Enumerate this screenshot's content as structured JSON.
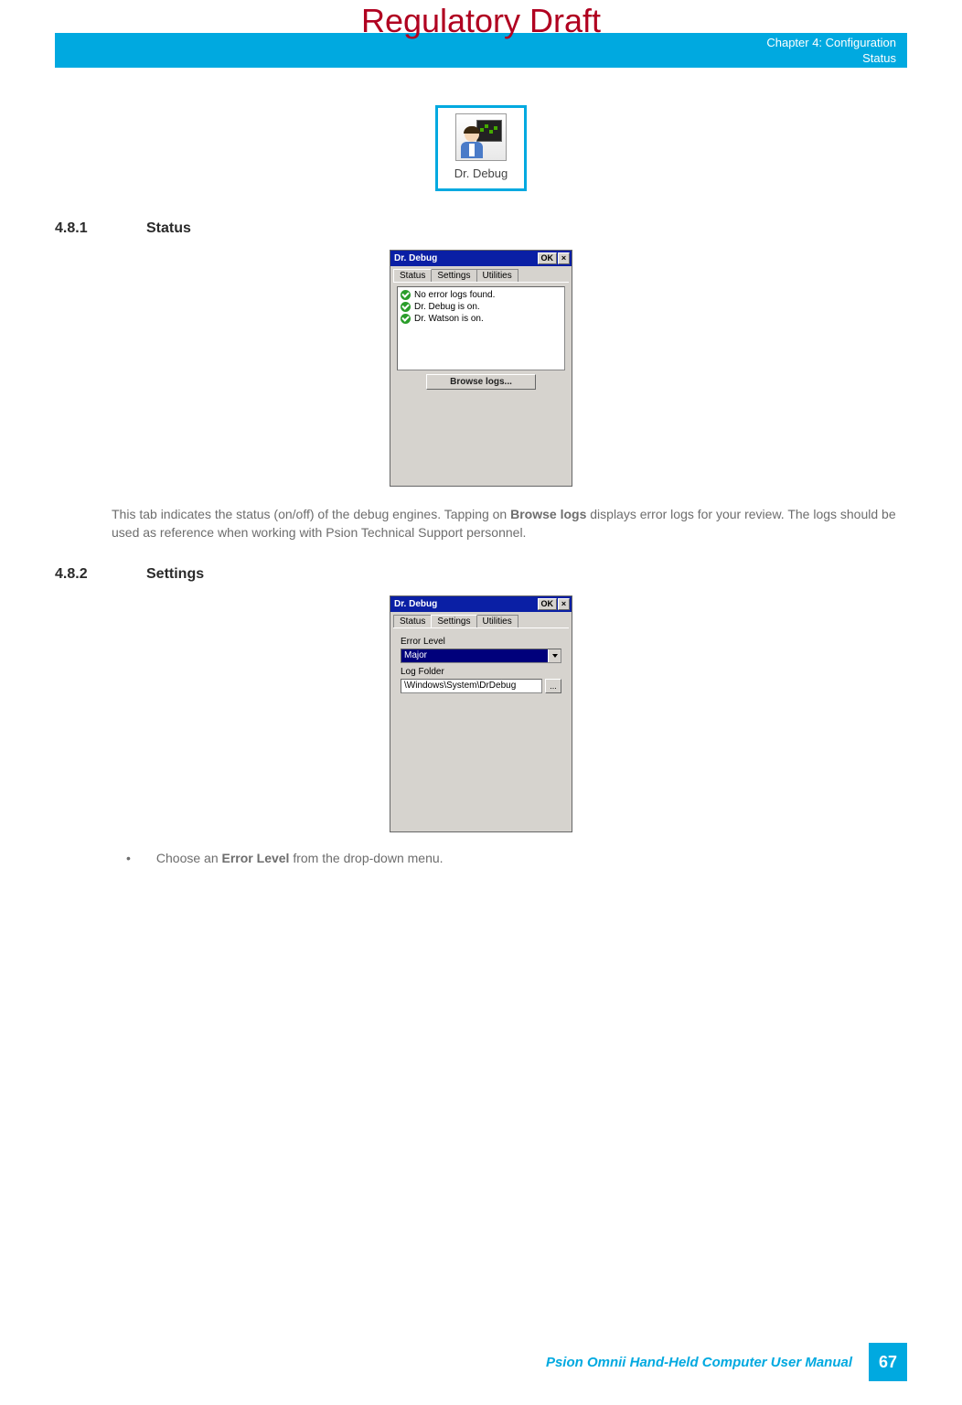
{
  "watermark": "Regulatory Draft",
  "header": {
    "chapter": "Chapter 4:  Configuration",
    "section": "Status"
  },
  "app_icon": {
    "label": "Dr. Debug"
  },
  "section_481": {
    "num": "4.8.1",
    "title": "Status"
  },
  "status_dialog": {
    "title": "Dr. Debug",
    "ok": "OK",
    "close": "×",
    "tabs": {
      "status": "Status",
      "settings": "Settings",
      "utilities": "Utilities"
    },
    "items": [
      "No error logs found.",
      "Dr. Debug is on.",
      "Dr. Watson is on."
    ],
    "browse": "Browse logs..."
  },
  "status_text": {
    "pre": "This tab indicates the status (on/off) of the debug engines. Tapping on ",
    "bold": "Browse logs",
    "post": " displays error logs for your review. The logs should be used as reference when working with Psion Technical Support personnel."
  },
  "section_482": {
    "num": "4.8.2",
    "title": "Settings"
  },
  "settings_dialog": {
    "title": "Dr. Debug",
    "ok": "OK",
    "close": "×",
    "tabs": {
      "status": "Status",
      "settings": "Settings",
      "utilities": "Utilities"
    },
    "error_level_label": "Error Level",
    "error_level_value": "Major",
    "log_folder_label": "Log Folder",
    "log_folder_value": "\\Windows\\System\\DrDebug",
    "browse_path": "..."
  },
  "bullet": {
    "pre": "Choose an ",
    "bold": "Error Level",
    "post": " from the drop-down menu."
  },
  "footer": {
    "manual": "Psion Omnii Hand-Held Computer User Manual",
    "page": "67"
  }
}
